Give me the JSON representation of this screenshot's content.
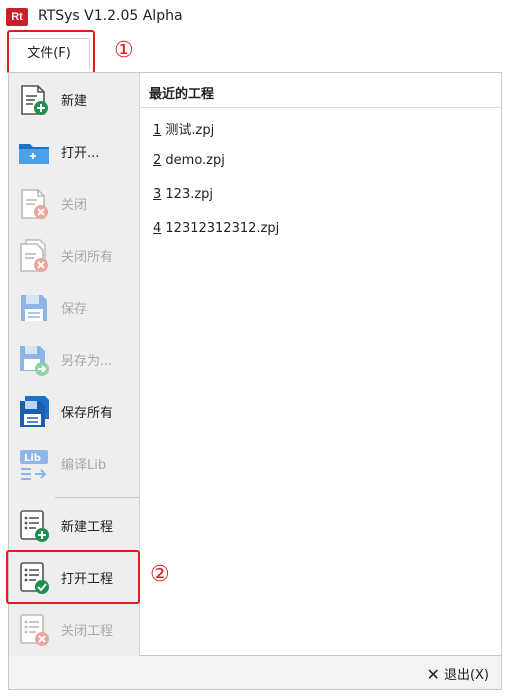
{
  "window": {
    "logo_text": "Rt",
    "title": "RTSys V1.2.05 Alpha"
  },
  "ribbon": {
    "file_tab": "文件(F)"
  },
  "annotations": {
    "marker1": "①",
    "marker2": "②",
    "color": "#e01e1e"
  },
  "menu": [
    {
      "label": "新建",
      "icon": "new-file-icon",
      "enabled": true
    },
    {
      "label": "打开...",
      "icon": "open-folder-icon",
      "enabled": true
    },
    {
      "label": "关闭",
      "icon": "close-file-icon",
      "enabled": false
    },
    {
      "label": "关闭所有",
      "icon": "close-all-files-icon",
      "enabled": false
    },
    {
      "label": "保存",
      "icon": "save-icon",
      "enabled": false
    },
    {
      "label": "另存为...",
      "icon": "save-as-icon",
      "enabled": false
    },
    {
      "label": "保存所有",
      "icon": "save-all-icon",
      "enabled": true
    },
    {
      "label": "编译Lib",
      "icon": "compile-lib-icon",
      "enabled": false
    },
    {
      "label": "新建工程",
      "icon": "new-project-icon",
      "enabled": true
    },
    {
      "label": "打开工程",
      "icon": "open-project-icon",
      "enabled": true
    },
    {
      "label": "关闭工程",
      "icon": "close-project-icon",
      "enabled": false
    }
  ],
  "recent": {
    "title": "最近的工程",
    "items": [
      {
        "num": "1",
        "name": " 测试.zpj"
      },
      {
        "num": "2",
        "name": " demo.zpj"
      },
      {
        "num": "3",
        "name": " 123.zpj"
      },
      {
        "num": "4",
        "name": " 12312312312.zpj"
      }
    ]
  },
  "status": {
    "exit_label": "退出(X)",
    "exit_icon": "close-x-icon"
  }
}
